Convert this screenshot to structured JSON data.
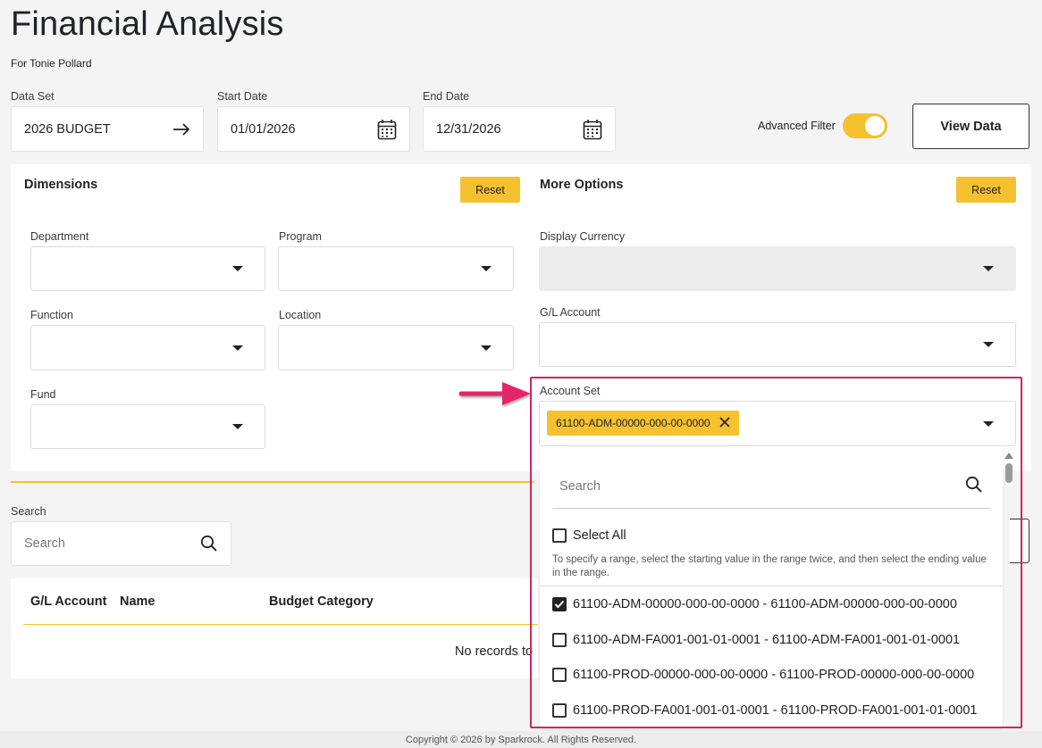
{
  "page": {
    "title": "Financial Analysis",
    "subtitle": "For Tonie Pollard"
  },
  "filters": {
    "data_set_label": "Data Set",
    "data_set_value": "2026 BUDGET",
    "start_date_label": "Start Date",
    "start_date_value": "01/01/2026",
    "end_date_label": "End Date",
    "end_date_value": "12/31/2026",
    "advanced_filter_label": "Advanced Filter",
    "advanced_filter_on": true,
    "view_data_label": "View Data"
  },
  "dimensions": {
    "title": "Dimensions",
    "reset_label": "Reset",
    "department_label": "Department",
    "program_label": "Program",
    "function_label": "Function",
    "location_label": "Location",
    "fund_label": "Fund"
  },
  "more_options": {
    "title": "More Options",
    "reset_label": "Reset",
    "display_currency_label": "Display Currency",
    "gl_account_label": "G/L Account",
    "account_set_label": "Account Set",
    "account_set_chip": "61100-ADM-00000-000-00-0000"
  },
  "account_set_dropdown": {
    "search_placeholder": "Search",
    "select_all_label": "Select All",
    "hint": "To specify a range, select the starting value in the range twice, and then select the ending value in the range.",
    "options": [
      {
        "label": "61100-ADM-00000-000-00-0000 - 61100-ADM-00000-000-00-0000",
        "checked": true
      },
      {
        "label": "61100-ADM-FA001-001-01-0001 - 61100-ADM-FA001-001-01-0001",
        "checked": false
      },
      {
        "label": "61100-PROD-00000-000-00-0000 - 61100-PROD-00000-000-00-0000",
        "checked": false
      },
      {
        "label": "61100-PROD-FA001-001-01-0001 - 61100-PROD-FA001-001-01-0001",
        "checked": false
      }
    ]
  },
  "grid": {
    "search_label": "Search",
    "search_placeholder": "Search",
    "columns": [
      "G/L Account",
      "Name",
      "Budget Category"
    ],
    "empty_text": "No records to"
  },
  "footer": {
    "copyright": "Copyright © 2026 by Sparkrock. All Rights Reserved."
  },
  "colors": {
    "accent": "#f5c12e",
    "highlight": "#d4245f"
  }
}
